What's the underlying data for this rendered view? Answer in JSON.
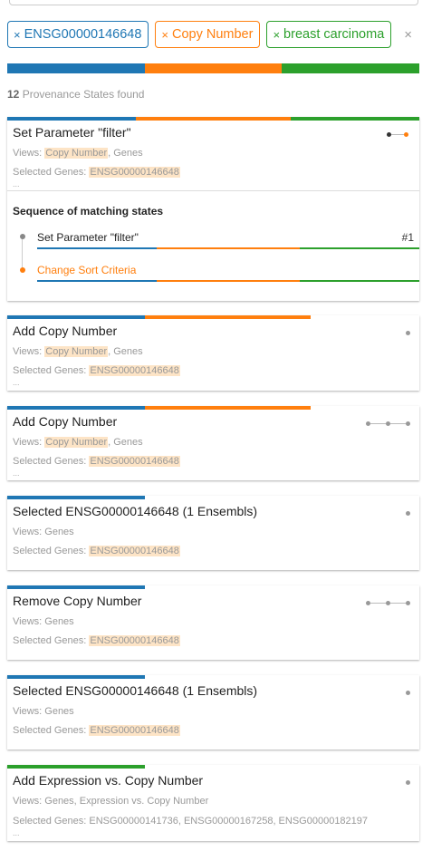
{
  "filter_tags": [
    {
      "close": "×",
      "label": "ENSG00000146648",
      "color": "#1f77b4"
    },
    {
      "close": "×",
      "label": "Copy Number",
      "color": "#ff7f0e"
    },
    {
      "close": "×",
      "label": "breast carcinoma",
      "color": "#2ca02c"
    }
  ],
  "clear_all": "×",
  "summary": {
    "count": "12",
    "text": "Provenance States found"
  },
  "labels": {
    "views": "Views: ",
    "selected_genes": "Selected Genes: ",
    "ellipsis": "..."
  },
  "cards": [
    {
      "title": "Set Parameter \"filter\"",
      "views_highlight": "Copy Number",
      "views_rest": ", Genes",
      "selected_genes": "ENSG00000146648",
      "sequence": {
        "heading": "Sequence of matching states",
        "items": [
          {
            "label": "Set Parameter \"filter\"",
            "number": "#1"
          },
          {
            "label": "Change Sort Criteria"
          }
        ]
      }
    },
    {
      "title": "Add Copy Number",
      "views_highlight": "Copy Number",
      "views_rest": ", Genes",
      "selected_genes": "ENSG00000146648"
    },
    {
      "title": "Add Copy Number",
      "views_highlight": "Copy Number",
      "views_rest": ", Genes",
      "selected_genes": "ENSG00000146648"
    },
    {
      "title": "Selected ENSG00000146648 (1 Ensembls)",
      "views": "Genes",
      "selected_genes": "ENSG00000146648"
    },
    {
      "title": "Remove Copy Number",
      "views": "Genes",
      "selected_genes": "ENSG00000146648"
    },
    {
      "title": "Selected ENSG00000146648 (1 Ensembls)",
      "views": "Genes",
      "selected_genes": "ENSG00000146648"
    },
    {
      "title": "Add Expression vs. Copy Number",
      "views": "Genes, Expression vs. Copy Number",
      "selected_genes_plain": "ENSG00000141736, ENSG00000167258, ENSG00000182197"
    }
  ],
  "colors": {
    "blue": "#1f77b4",
    "orange": "#ff7f0e",
    "green": "#2ca02c",
    "highlight": "#fde4c6"
  }
}
